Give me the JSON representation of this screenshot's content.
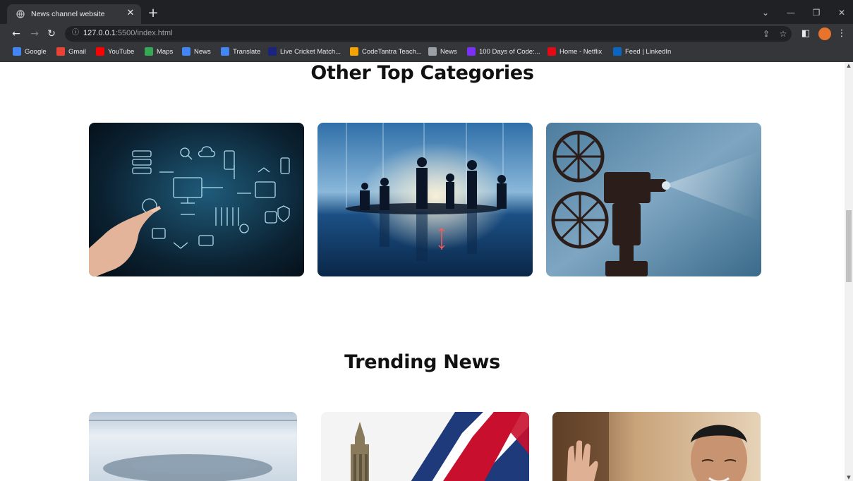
{
  "browser": {
    "tab_title": "News channel website",
    "tab_close": "✕",
    "new_tab": "+",
    "url_host": "127.0.0.1",
    "url_rest": ":5500/index.html",
    "window_controls": [
      "⌄",
      "—",
      "❐",
      "✕"
    ],
    "bookmarks": [
      {
        "label": "Google",
        "icon": "google-icon",
        "color": "#4285f4"
      },
      {
        "label": "Gmail",
        "icon": "gmail-icon",
        "color": "#ea4335"
      },
      {
        "label": "YouTube",
        "icon": "youtube-icon",
        "color": "#ff0000"
      },
      {
        "label": "Maps",
        "icon": "maps-icon",
        "color": "#34a853"
      },
      {
        "label": "News",
        "icon": "news-icon",
        "color": "#4285f4"
      },
      {
        "label": "Translate",
        "icon": "translate-icon",
        "color": "#4285f4"
      },
      {
        "label": "Live Cricket Match...",
        "icon": "cricket-icon",
        "color": "#1a237e"
      },
      {
        "label": "CodeTantra Teach...",
        "icon": "codetantra-icon",
        "color": "#f4a300"
      },
      {
        "label": "News",
        "icon": "globe-icon",
        "color": "#9aa0a6"
      },
      {
        "label": "100 Days of Code:...",
        "icon": "hundred-days-icon",
        "color": "#7b2ff7"
      },
      {
        "label": "Home - Netflix",
        "icon": "netflix-icon",
        "color": "#e50914"
      },
      {
        "label": "Feed | LinkedIn",
        "icon": "linkedin-icon",
        "color": "#0a66c2"
      }
    ]
  },
  "page": {
    "categories_title": "Other Top Categories",
    "trending_title": "Trending News",
    "category_cards": [
      {
        "name": "technology-card",
        "theme": "technology"
      },
      {
        "name": "business-card",
        "theme": "business"
      },
      {
        "name": "entertainment-card",
        "theme": "entertainment"
      }
    ],
    "trending_cards": [
      {
        "name": "trending-card-ice",
        "theme": "ice"
      },
      {
        "name": "trending-card-uk",
        "theme": "uk"
      },
      {
        "name": "trending-card-person",
        "theme": "person"
      }
    ]
  },
  "colors": {
    "chrome_dark": "#202124",
    "chrome_toolbar": "#35363a",
    "heading": "#111111"
  }
}
